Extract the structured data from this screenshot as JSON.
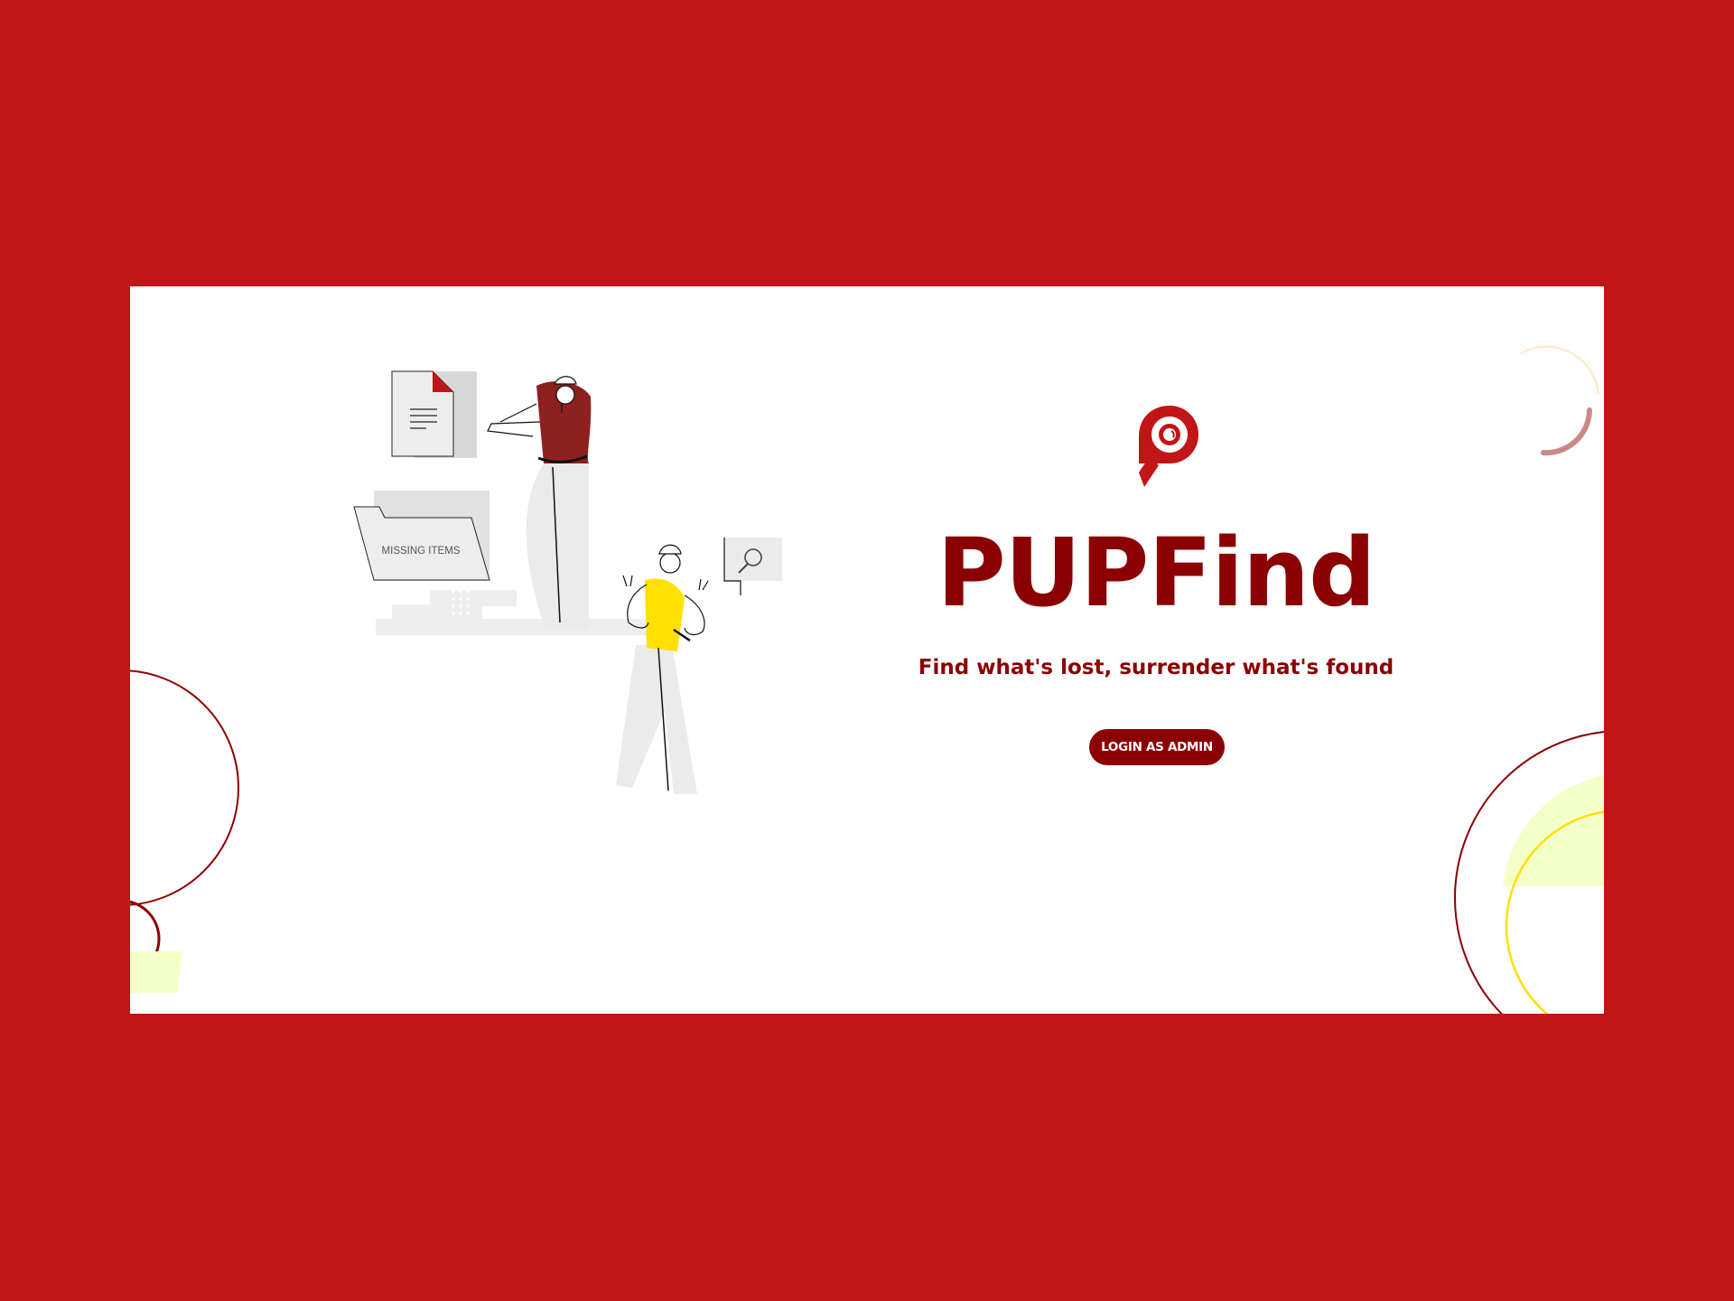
{
  "app": {
    "title": "PUPFind",
    "tagline": "Find what's lost, surrender what's found"
  },
  "actions": {
    "login_admin_label": "LOGIN AS ADMIN"
  },
  "illustration": {
    "folder_label": "MISSING ITEMS"
  },
  "colors": {
    "background": "#C21517",
    "brand_primary": "#8B0000",
    "logo_red": "#C21517",
    "accent_yellow": "#FFE000",
    "pale_yellow": "#F4FFC8",
    "card": "#FFFFFF"
  },
  "icons": [
    "pupfind-logo-icon",
    "document-icon",
    "folder-icon",
    "magnifier-icon"
  ]
}
